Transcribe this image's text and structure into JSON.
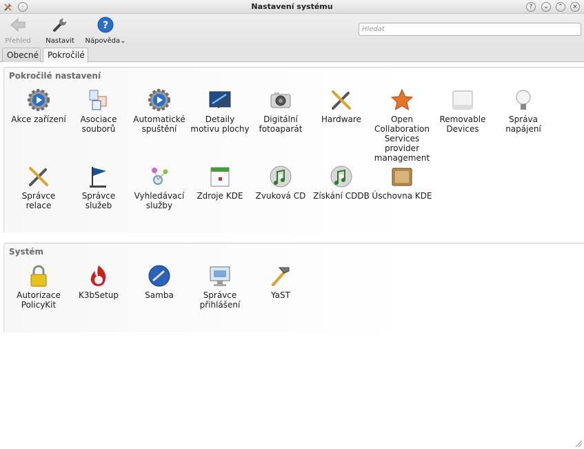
{
  "window": {
    "title": "Nastavení systému"
  },
  "toolbar": {
    "overview_label": "Přehled",
    "configure_label": "Nastavit",
    "help_label": "Nápověda"
  },
  "search": {
    "placeholder": "Hledat"
  },
  "tabs": [
    {
      "label": "Obecné"
    },
    {
      "label": "Pokročilé"
    }
  ],
  "groups": {
    "advanced": {
      "title": "Pokročilé nastavení",
      "items": [
        {
          "label": "Akce zařízení",
          "icon": "gear-play-icon"
        },
        {
          "label": "Asociace souborů",
          "icon": "file-associations-icon"
        },
        {
          "label": "Automatické spuštění",
          "icon": "gear-autostart-icon"
        },
        {
          "label": "Detaily motivu plochy",
          "icon": "desktop-theme-icon"
        },
        {
          "label": "Digitální fotoaparát",
          "icon": "camera-icon"
        },
        {
          "label": "Hardware",
          "icon": "wrench-screwdriver-icon"
        },
        {
          "label": "Open Collaboration Services provider management",
          "icon": "star-icon"
        },
        {
          "label": "Removable Devices",
          "icon": "drive-icon"
        },
        {
          "label": "Správa napájení",
          "icon": "lightbulb-icon"
        },
        {
          "label": "Správce relace",
          "icon": "session-tools-icon"
        },
        {
          "label": "Správce služeb",
          "icon": "flag-icon"
        },
        {
          "label": "Vyhledávací služby",
          "icon": "network-search-icon"
        },
        {
          "label": "Zdroje KDE",
          "icon": "calendar-icon"
        },
        {
          "label": "Zvuková CD",
          "icon": "audio-cd-icon"
        },
        {
          "label": "Získání CDDB",
          "icon": "cddb-icon"
        },
        {
          "label": "Úschovna KDE",
          "icon": "wallet-icon"
        }
      ]
    },
    "system": {
      "title": "Systém",
      "items": [
        {
          "label": "Autorizace PolicyKit",
          "icon": "lock-icon"
        },
        {
          "label": "K3bSetup",
          "icon": "k3b-flame-icon"
        },
        {
          "label": "Samba",
          "icon": "samba-globe-icon"
        },
        {
          "label": "Správce přihlášení",
          "icon": "login-monitor-icon"
        },
        {
          "label": "YaST",
          "icon": "hammer-icon"
        }
      ]
    }
  },
  "colors": {
    "group_title": "#6b6b6b",
    "help_blue": "#2a6fc9",
    "star_orange": "#e8742a"
  }
}
